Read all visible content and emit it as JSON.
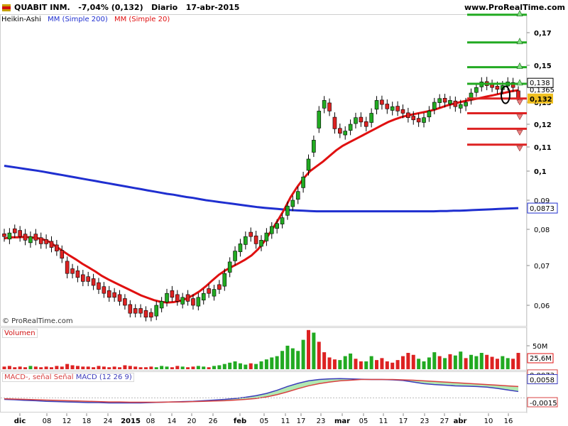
{
  "header": {
    "instrument": "QUABIT INM.",
    "change": "-7,04% (0,132)",
    "period": "Diario",
    "date": "17-abr-2015",
    "site": "www.ProRealTime.com"
  },
  "legend": {
    "chart_style": "Heikin-Ashi",
    "ma200": "MM (Simple 200)",
    "ma20": "MM (Simple 20)"
  },
  "copyright": "© ProRealTime.com",
  "panels": {
    "volume_label": "Volumen",
    "macd_label1": "MACD-, señal",
    "macd_label2": "Señal",
    "macd_label3": "MACD (12 26 9)"
  },
  "colors": {
    "up": "#22aa22",
    "down": "#dd2222",
    "ma200": "#1f2fd0",
    "ma20": "#e01010",
    "macd": "#3b3bbb",
    "signal": "#d84040"
  },
  "chart_data": [
    {
      "type": "candlestick",
      "title": "QUABIT INM. Diario",
      "style": "Heikin-Ashi",
      "x_tick_labels": [
        "dic",
        "08",
        "12",
        "18",
        "24",
        "2015",
        "08",
        "14",
        "20",
        "26",
        "feb",
        "05",
        "11",
        "17",
        "23",
        "mar",
        "05",
        "11",
        "17",
        "23",
        "27",
        "abr",
        "10",
        "16"
      ],
      "y_ticks": [
        0.06,
        0.07,
        0.08,
        0.09,
        0.1,
        0.11,
        0.12,
        0.13,
        0.15,
        0.17
      ],
      "y_tick_labels": [
        "0,06",
        "0,07",
        "0,08",
        "0,09",
        "0,1",
        "0,11",
        "0,12",
        "0,13",
        "0,15",
        "0,17"
      ],
      "ylim": [
        0.055,
        0.182
      ],
      "price_labels": [
        {
          "label": "0,138",
          "value": 0.138,
          "kind": "box"
        },
        {
          "label": "0,1365",
          "value": 0.1365,
          "kind": "red-text"
        },
        {
          "label": "0,132",
          "value": 0.132,
          "kind": "yellow"
        },
        {
          "label": "0,0873",
          "value": 0.0873,
          "kind": "blue-text"
        }
      ],
      "close": [
        0.078,
        0.079,
        0.079,
        0.078,
        0.077,
        0.078,
        0.077,
        0.076,
        0.076,
        0.075,
        0.074,
        0.072,
        0.068,
        0.068,
        0.067,
        0.066,
        0.066,
        0.065,
        0.064,
        0.063,
        0.062,
        0.062,
        0.061,
        0.06,
        0.058,
        0.058,
        0.058,
        0.057,
        0.057,
        0.06,
        0.061,
        0.063,
        0.062,
        0.061,
        0.062,
        0.061,
        0.06,
        0.062,
        0.063,
        0.063,
        0.064,
        0.064,
        0.068,
        0.071,
        0.074,
        0.076,
        0.078,
        0.078,
        0.076,
        0.077,
        0.079,
        0.081,
        0.082,
        0.084,
        0.088,
        0.09,
        0.093,
        0.098,
        0.105,
        0.113,
        0.126,
        0.131,
        0.126,
        0.118,
        0.116,
        0.117,
        0.12,
        0.123,
        0.121,
        0.119,
        0.125,
        0.131,
        0.129,
        0.127,
        0.128,
        0.126,
        0.125,
        0.123,
        0.122,
        0.121,
        0.123,
        0.126,
        0.13,
        0.132,
        0.13,
        0.131,
        0.128,
        0.129,
        0.13,
        0.135,
        0.138,
        0.141,
        0.139,
        0.138,
        0.137,
        0.139,
        0.141,
        0.138,
        0.132
      ],
      "ma20": [
        0.0775,
        0.0778,
        0.0778,
        0.0779,
        0.0778,
        0.0776,
        0.0772,
        0.0765,
        0.0752,
        0.074,
        0.0728,
        0.0717,
        0.0705,
        0.0695,
        0.0685,
        0.0674,
        0.0665,
        0.0657,
        0.0649,
        0.0641,
        0.0633,
        0.0625,
        0.0619,
        0.0613,
        0.0609,
        0.0607,
        0.0608,
        0.0611,
        0.0617,
        0.0625,
        0.0635,
        0.0648,
        0.0663,
        0.0677,
        0.0688,
        0.0697,
        0.0706,
        0.0716,
        0.0728,
        0.0745,
        0.0767,
        0.0795,
        0.0829,
        0.0867,
        0.091,
        0.0945,
        0.0975,
        0.1,
        0.102,
        0.104,
        0.1063,
        0.1086,
        0.1105,
        0.112,
        0.1135,
        0.115,
        0.1165,
        0.118,
        0.1195,
        0.121,
        0.1222,
        0.1232,
        0.124,
        0.1246,
        0.1252,
        0.1258,
        0.1265,
        0.1275,
        0.1285,
        0.1293,
        0.13,
        0.1308,
        0.1315,
        0.1322,
        0.133,
        0.1337,
        0.1345,
        0.1352,
        0.136,
        0.1365
      ],
      "ma200": [
        0.1022,
        0.1018,
        0.1014,
        0.101,
        0.1006,
        0.1002,
        0.0998,
        0.0994,
        0.099,
        0.0986,
        0.0982,
        0.0978,
        0.0974,
        0.097,
        0.0966,
        0.0962,
        0.0958,
        0.0954,
        0.095,
        0.0946,
        0.0942,
        0.0938,
        0.0934,
        0.093,
        0.0926,
        0.0922,
        0.0919,
        0.0915,
        0.0911,
        0.0908,
        0.0904,
        0.09,
        0.0897,
        0.0894,
        0.0891,
        0.0888,
        0.0885,
        0.0882,
        0.0879,
        0.0876,
        0.0874,
        0.0872,
        0.087,
        0.0868,
        0.0866,
        0.0865,
        0.0864,
        0.0863,
        0.0862,
        0.0862,
        0.0862,
        0.0862,
        0.0862,
        0.0862,
        0.0862,
        0.0862,
        0.0862,
        0.0862,
        0.0862,
        0.0862,
        0.0862,
        0.0862,
        0.0862,
        0.0862,
        0.0862,
        0.0862,
        0.0862,
        0.0863,
        0.0863,
        0.0864,
        0.0864,
        0.0865,
        0.0866,
        0.0867,
        0.0868,
        0.0869,
        0.087,
        0.0871,
        0.0872,
        0.0873
      ],
      "levels_up": [
        0.181,
        0.164,
        0.149,
        0.14
      ],
      "levels_down": [
        0.132,
        0.125,
        0.118,
        0.111
      ]
    },
    {
      "type": "bar",
      "title": "Volumen",
      "y_tick_labels": [
        "50M",
        "25,6M"
      ],
      "values_m": [
        4,
        5,
        3,
        4,
        3,
        5,
        4,
        3,
        4,
        3,
        5,
        4,
        8,
        6,
        5,
        4,
        4,
        3,
        5,
        4,
        3,
        4,
        3,
        6,
        5,
        4,
        3,
        3,
        4,
        3,
        5,
        4,
        3,
        5,
        4,
        3,
        4,
        5,
        4,
        3,
        5,
        6,
        8,
        10,
        12,
        9,
        7,
        9,
        8,
        12,
        15,
        18,
        20,
        28,
        36,
        32,
        28,
        45,
        60,
        56,
        42,
        26,
        18,
        15,
        14,
        20,
        24,
        16,
        12,
        12,
        20,
        14,
        17,
        12,
        10,
        14,
        20,
        25,
        22,
        16,
        12,
        18,
        26,
        20,
        17,
        23,
        21,
        27,
        17,
        22,
        20,
        25,
        22,
        19,
        16,
        20,
        17,
        16,
        25
      ],
      "down_flags": [
        1,
        1,
        1,
        1,
        1,
        0,
        1,
        1,
        1,
        1,
        1,
        1,
        1,
        1,
        1,
        1,
        1,
        1,
        1,
        1,
        1,
        1,
        1,
        1,
        1,
        1,
        1,
        1,
        1,
        0,
        0,
        0,
        1,
        1,
        0,
        1,
        1,
        0,
        0,
        1,
        0,
        0,
        0,
        0,
        0,
        0,
        0,
        1,
        0,
        0,
        0,
        0,
        0,
        0,
        0,
        0,
        0,
        0,
        1,
        0,
        1,
        1,
        1,
        1,
        0,
        0,
        0,
        1,
        1,
        0,
        0,
        1,
        1,
        1,
        1,
        1,
        1,
        1,
        1,
        0,
        0,
        0,
        0,
        1,
        0,
        1,
        0,
        0,
        1,
        0,
        0,
        0,
        1,
        1,
        1,
        0,
        0,
        1,
        1
      ]
    },
    {
      "type": "line",
      "title": "MACD (12 26 9)",
      "y_tick_labels": [
        "0,0073",
        "0,0058",
        "-0,0015"
      ],
      "series": [
        {
          "name": "MACD",
          "values": [
            -0.0005,
            -0.0006,
            -0.0008,
            -0.0009,
            -0.0011,
            -0.0012,
            -0.0013,
            -0.0014,
            -0.0015,
            -0.0015,
            -0.0016,
            -0.0016,
            -0.0016,
            -0.0016,
            -0.0015,
            -0.0014,
            -0.0013,
            -0.0012,
            -0.0011,
            -0.0009,
            -0.0007,
            -0.0005,
            -0.0002,
            0.0002,
            0.0007,
            0.0014,
            0.0024,
            0.0036,
            0.0046,
            0.0054,
            0.0058,
            0.006,
            0.0061,
            0.006,
            0.0059,
            0.0058,
            0.0058,
            0.0057,
            0.0055,
            0.005,
            0.0045,
            0.0042,
            0.004,
            0.0038,
            0.0037,
            0.0036,
            0.0034,
            0.003,
            0.0025,
            0.002
          ]
        },
        {
          "name": "Señal",
          "values": [
            -0.0003,
            -0.0004,
            -0.0005,
            -0.0006,
            -0.0007,
            -0.0008,
            -0.0009,
            -0.001,
            -0.0011,
            -0.0012,
            -0.0013,
            -0.0013,
            -0.0014,
            -0.0014,
            -0.0014,
            -0.0014,
            -0.0013,
            -0.0013,
            -0.0012,
            -0.0011,
            -0.001,
            -0.0009,
            -0.0007,
            -0.0005,
            -0.0002,
            0.0003,
            0.001,
            0.0019,
            0.0029,
            0.0038,
            0.0045,
            0.005,
            0.0054,
            0.0056,
            0.0058,
            0.0058,
            0.0058,
            0.0058,
            0.0057,
            0.0056,
            0.0054,
            0.0052,
            0.005,
            0.0048,
            0.0046,
            0.0044,
            0.0042,
            0.004,
            0.0038,
            0.0036
          ]
        }
      ]
    }
  ]
}
